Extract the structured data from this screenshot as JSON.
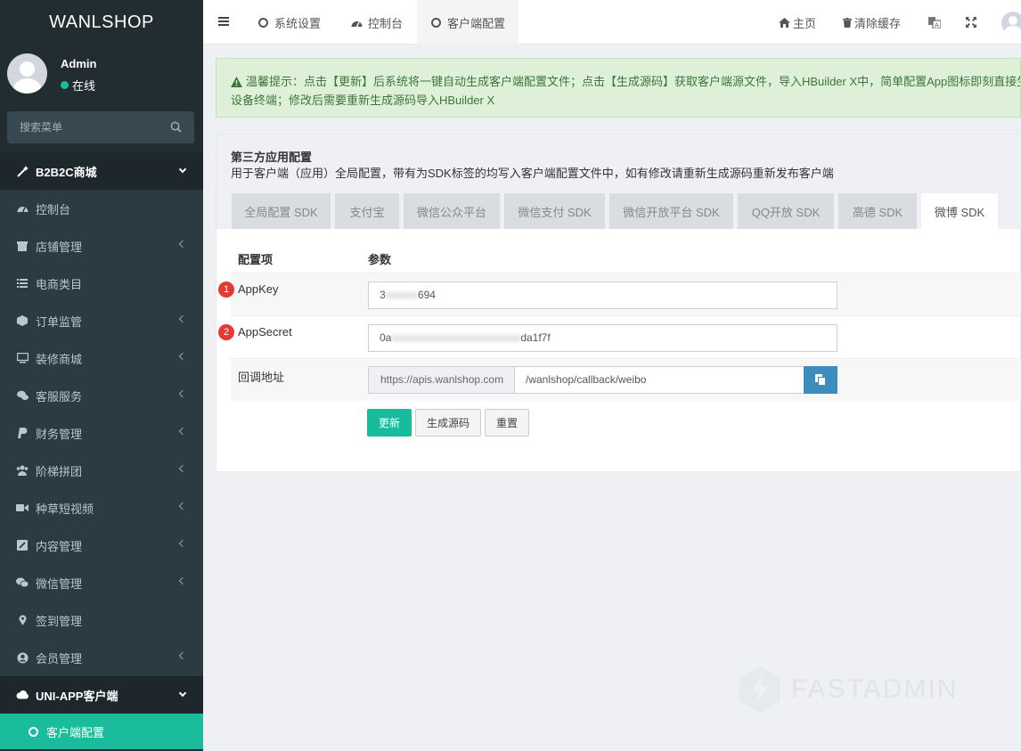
{
  "sidebar": {
    "logo": "WANLSHOP",
    "user": {
      "name": "Admin",
      "status": "在线"
    },
    "search_placeholder": "搜索菜单",
    "section1": "B2B2C商城",
    "items": [
      {
        "label": "控制台",
        "icon": "dashboard-icon"
      },
      {
        "label": "店铺管理",
        "icon": "store-icon"
      },
      {
        "label": "电商类目",
        "icon": "list-icon"
      },
      {
        "label": "订单监管",
        "icon": "cube-icon"
      },
      {
        "label": "装修商城",
        "icon": "monitor-icon"
      },
      {
        "label": "客服服务",
        "icon": "chat-icon"
      },
      {
        "label": "财务管理",
        "icon": "paypal-icon"
      },
      {
        "label": "阶梯拼团",
        "icon": "users-icon"
      },
      {
        "label": "种草短视频",
        "icon": "video-icon"
      },
      {
        "label": "内容管理",
        "icon": "edit-icon"
      },
      {
        "label": "微信管理",
        "icon": "wechat-icon"
      },
      {
        "label": "签到管理",
        "icon": "map-marker-icon"
      },
      {
        "label": "会员管理",
        "icon": "user-circle-icon"
      }
    ],
    "section2": "UNI-APP客户端",
    "active_item": "客户端配置"
  },
  "topbar": {
    "tabs": [
      "系统设置",
      "控制台",
      "客户端配置"
    ],
    "home": "主页",
    "clear_cache": "清除缓存"
  },
  "alert": {
    "line1": "温馨提示：点击【更新】后系统将一键自动生成客户端配置文件；点击【生成源码】获取客户端源文件，导入HBuilder X中，简单配置App图标即刻直接生成",
    "line2": "设备终端；修改后需要重新生成源码导入HBuilder X"
  },
  "panel": {
    "title": "第三方应用配置",
    "subtitle": "用于客户端（应用）全局配置，带有为SDK标签的均写入客户端配置文件中，如有修改请重新生成源码重新发布客户端",
    "tabs": [
      "全局配置 SDK",
      "支付宝",
      "微信公众平台",
      "微信支付 SDK",
      "微信开放平台 SDK",
      "QQ开放 SDK",
      "高德 SDK",
      "微博 SDK"
    ],
    "col_item": "配置项",
    "col_param": "参数",
    "rows": {
      "appkey": {
        "badge": "1",
        "label": "AppKey",
        "value_start": "3",
        "value_end": "694"
      },
      "appsecret": {
        "badge": "2",
        "label": "AppSecret",
        "value_start": "0a",
        "value_end": "da1f7f"
      },
      "callback": {
        "label": "回调地址",
        "prefix": "https://apis.wanlshop.com",
        "value": "/wanlshop/callback/weibo"
      }
    },
    "buttons": {
      "update": "更新",
      "generate": "生成源码",
      "reset": "重置"
    }
  },
  "watermark": "FASTADMIN",
  "colors": {
    "sidebar": "#222d32",
    "accent": "#1abc9c",
    "primary": "#3c8dbc",
    "danger": "#e53935"
  }
}
